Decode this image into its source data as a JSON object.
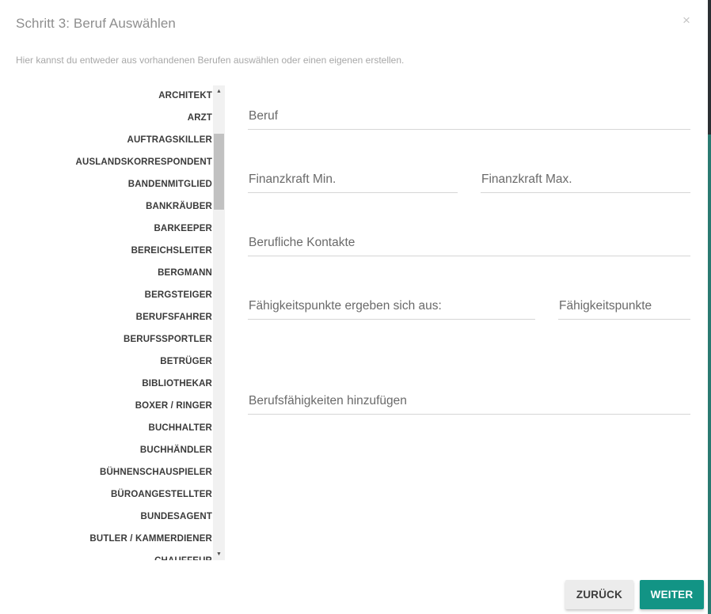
{
  "dialog": {
    "title": "Schritt 3: Beruf Auswählen",
    "close_symbol": "×",
    "description": "Hier kannst du entweder aus vorhandenen Berufen auswählen oder einen eigenen erstellen."
  },
  "profession_list": {
    "items": [
      "ARCHITEKT",
      "ARZT",
      "AUFTRAGSKILLER",
      "AUSLANDSKORRESPONDENT",
      "BANDENMITGLIED",
      "BANKRÄUBER",
      "BARKEEPER",
      "BEREICHSLEITER",
      "BERGMANN",
      "BERGSTEIGER",
      "BERUFSFAHRER",
      "BERUFSSPORTLER",
      "BETRÜGER",
      "BIBLIOTHEKAR",
      "BOXER / RINGER",
      "BUCHHALTER",
      "BUCHHÄNDLER",
      "BÜHNENSCHAUSPIELER",
      "BÜROANGESTELLTER",
      "BUNDESAGENT",
      "BUTLER / KAMMERDIENER",
      "CHAUFFEUR"
    ],
    "scroll_up_symbol": "▲",
    "scroll_down_symbol": "▼"
  },
  "form": {
    "beruf_label": "Beruf",
    "finanzkraft_min_label": "Finanzkraft Min.",
    "finanzkraft_max_label": "Finanzkraft Max.",
    "kontakte_label": "Berufliche Kontakte",
    "punkte_quelle_label": "Fähigkeitspunkte ergeben sich aus:",
    "punkte_label": "Fähigkeitspunkte",
    "faehigkeiten_label": "Berufsfähigkeiten hinzufügen"
  },
  "footer": {
    "back_label": "ZURÜCK",
    "next_label": "WEITER"
  },
  "colors": {
    "accent": "#129485",
    "title_text": "#8e8e8e",
    "list_text": "#3a3a3a",
    "field_underline": "#d6d6d6",
    "back_button_bg": "#ececec"
  }
}
